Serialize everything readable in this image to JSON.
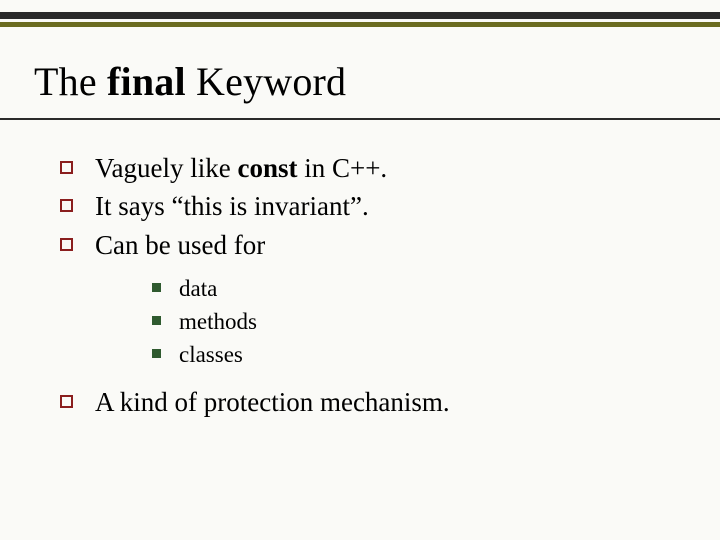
{
  "title_pre": "The ",
  "title_bold": "final",
  "title_post": " Keyword",
  "bullets": [
    {
      "pre": "Vaguely like ",
      "bold": "const",
      "post": " in C++."
    },
    {
      "pre": "It says “this is invariant”.",
      "bold": "",
      "post": ""
    },
    {
      "pre": "Can be used for",
      "bold": "",
      "post": ""
    }
  ],
  "sub": [
    "data",
    "methods",
    "classes"
  ],
  "last": "A kind of protection mechanism."
}
